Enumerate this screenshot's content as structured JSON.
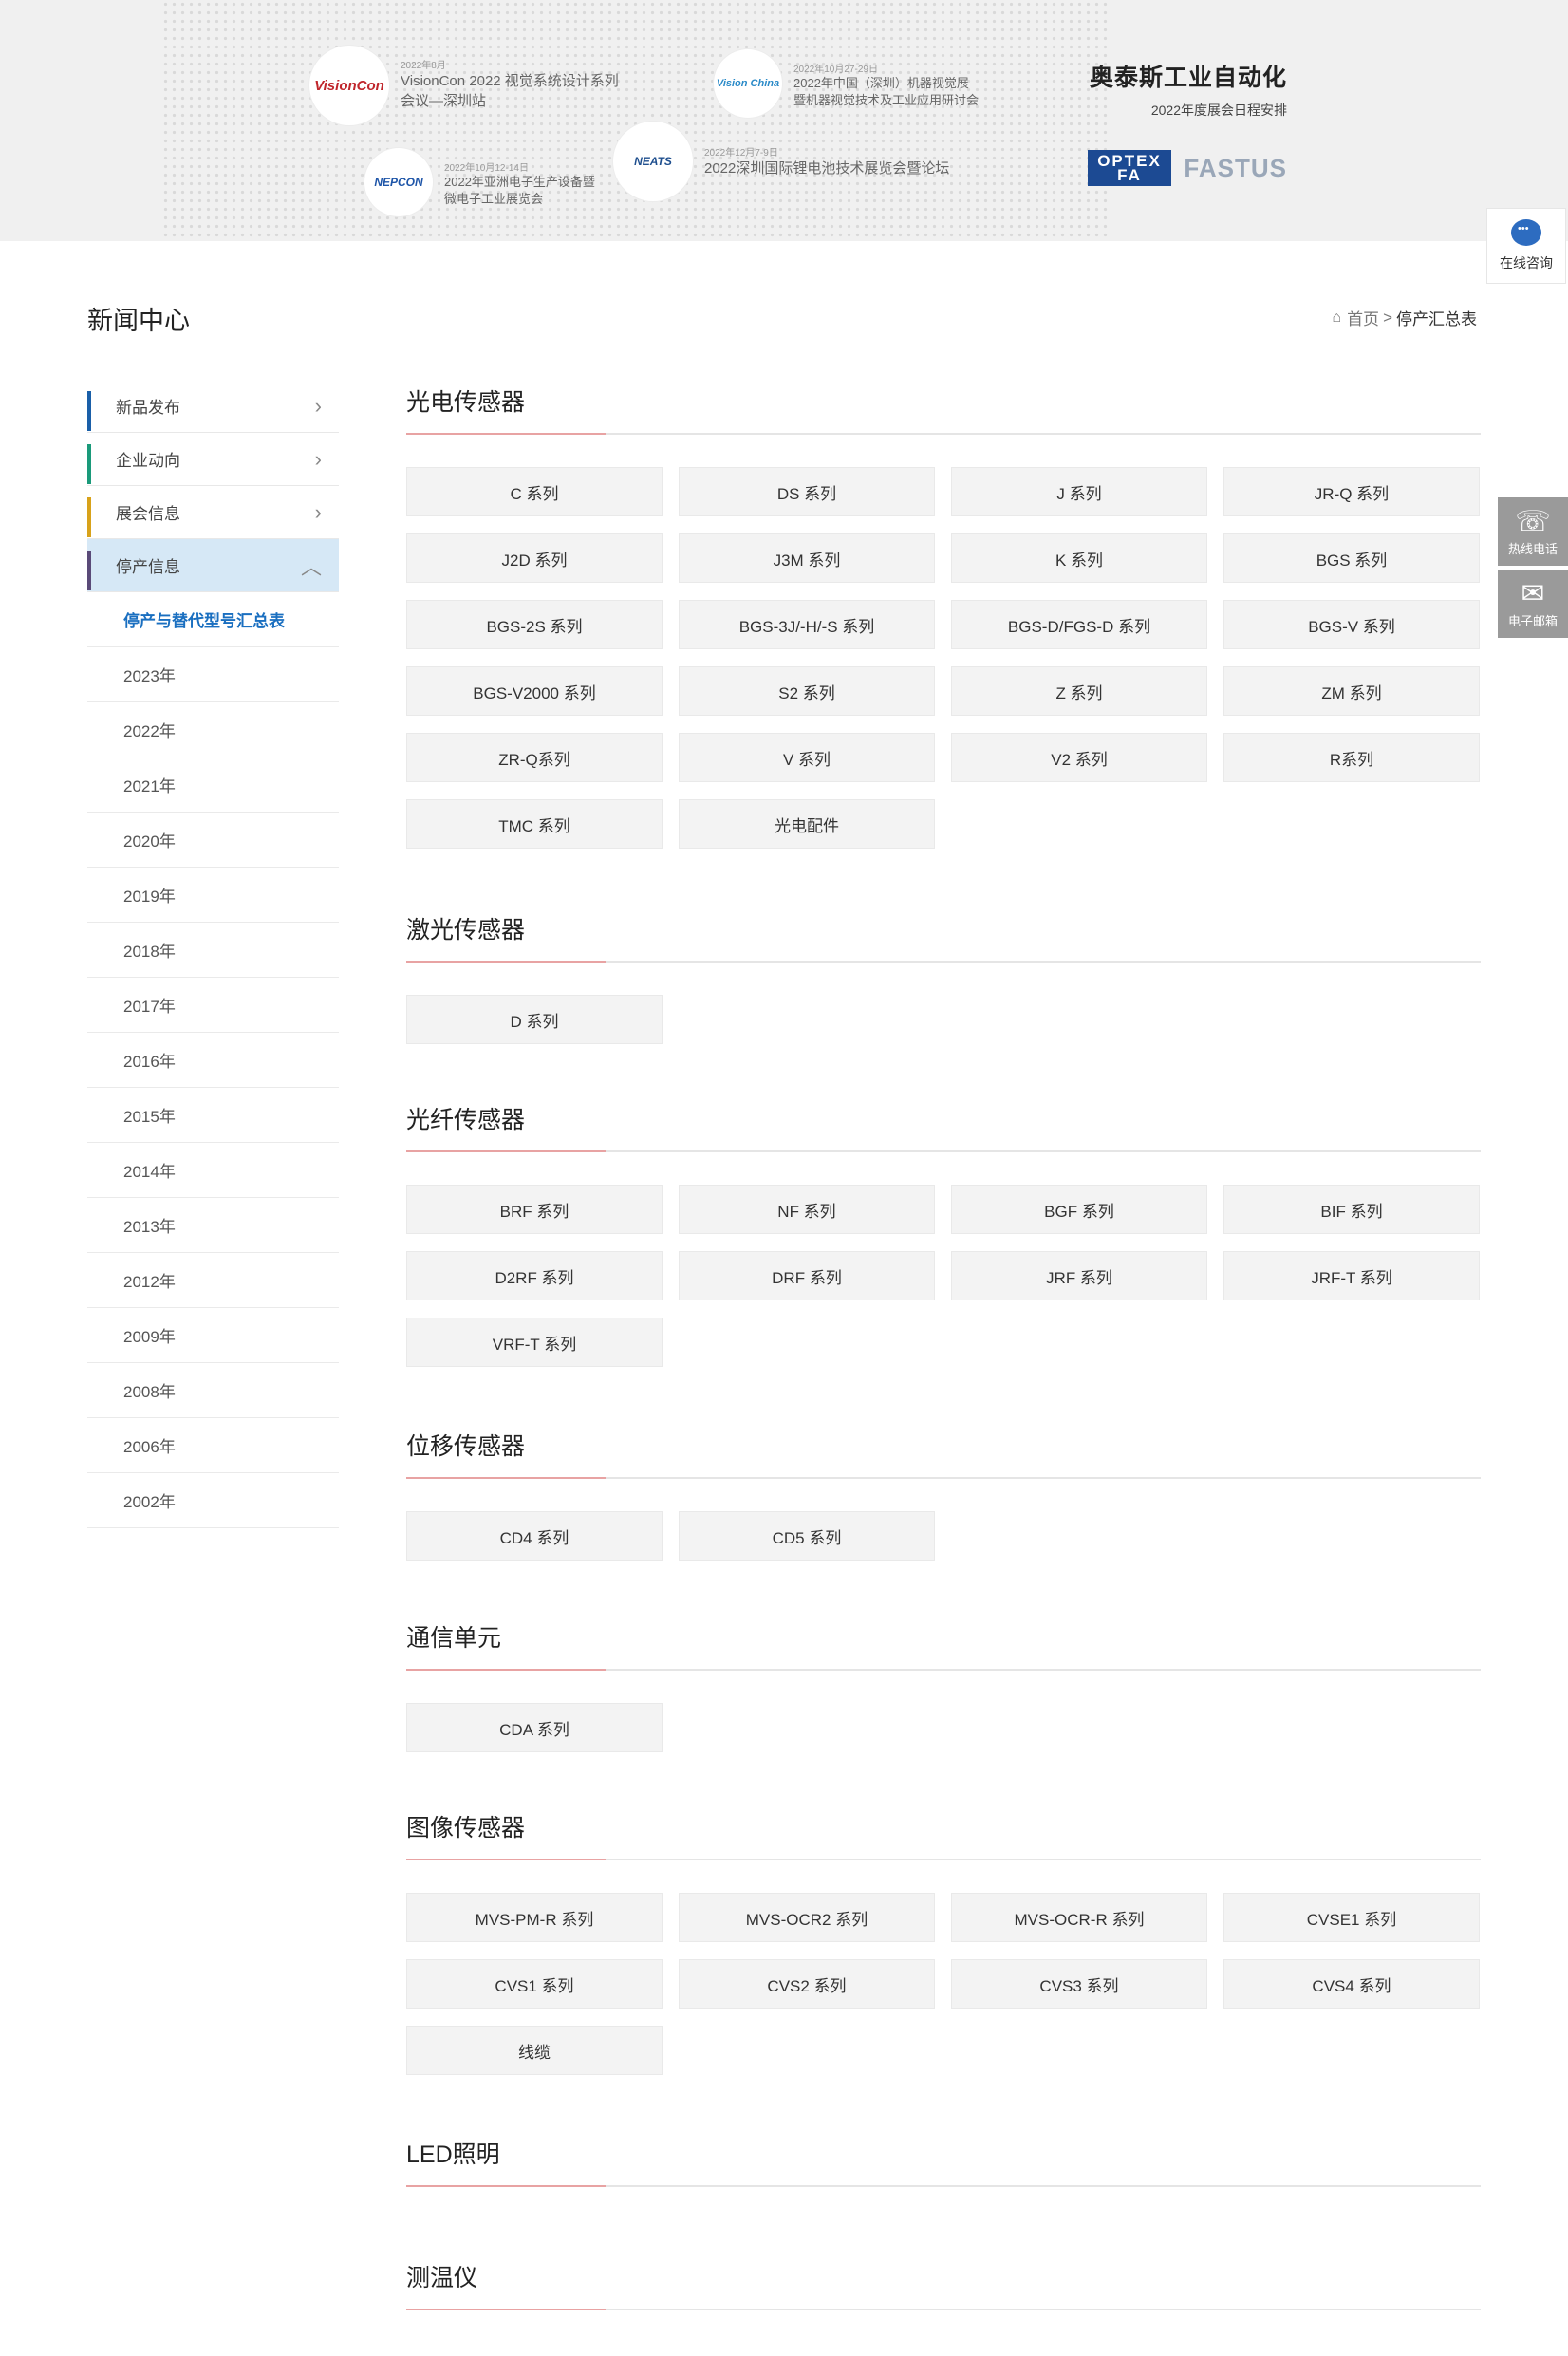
{
  "banner": {
    "events": [
      {
        "logo": "VisionCon",
        "date": "2022年8月",
        "title_line1": "VisionCon 2022 视觉系统设计系列",
        "title_line2": "会议—深圳站"
      },
      {
        "logo": "Vision China",
        "date": "2022年10月27-29日",
        "title_line1": "2022年中国（深圳）机器视觉展",
        "title_line2": "暨机器视觉技术及工业应用研讨会"
      },
      {
        "logo": "NEPCON",
        "date": "2022年10月12-14日",
        "title_line1": "2022年亚洲电子生产设备暨",
        "title_line2": "微电子工业展览会"
      },
      {
        "logo": "NEATS",
        "date": "2022年12月7-9日",
        "title_line1": "2022深圳国际锂电池技术展览会暨论坛",
        "title_line2": ""
      }
    ],
    "brand_title": "奥泰斯工业自动化",
    "brand_sub": "2022年度展会日程安排",
    "logo_optex_top": "OPTEX",
    "logo_optex_bottom": "FA",
    "logo_fastus": "FASTUS"
  },
  "float": {
    "consult": "在线咨询",
    "hotline": "热线电话",
    "email": "电子邮箱"
  },
  "header": {
    "title": "新闻中心",
    "breadcrumb_home": "首页",
    "breadcrumb_sep": ">",
    "breadcrumb_current": "停产汇总表"
  },
  "sidebar": {
    "main_items": [
      {
        "label": "新品发布",
        "color": "#1a5fa8"
      },
      {
        "label": "企业动向",
        "color": "#1a9a7a"
      },
      {
        "label": "展会信息",
        "color": "#d8a21a"
      },
      {
        "label": "停产信息",
        "color": "#5a4a78"
      }
    ],
    "sub_items": [
      "停产与替代型号汇总表",
      "2023年",
      "2022年",
      "2021年",
      "2020年",
      "2019年",
      "2018年",
      "2017年",
      "2016年",
      "2015年",
      "2014年",
      "2013年",
      "2012年",
      "2009年",
      "2008年",
      "2006年",
      "2002年"
    ]
  },
  "sections": [
    {
      "title": "光电传感器",
      "items": [
        "C 系列",
        "DS 系列",
        "J 系列",
        "JR-Q 系列",
        "J2D 系列",
        "J3M 系列",
        "K 系列",
        "BGS 系列",
        "BGS-2S 系列",
        "BGS-3J/-H/-S 系列",
        "BGS-D/FGS-D 系列",
        "BGS-V 系列",
        "BGS-V2000 系列",
        "S2 系列",
        "Z 系列",
        "ZM 系列",
        "ZR-Q系列",
        "V 系列",
        "V2 系列",
        "R系列",
        "TMC 系列",
        "光电配件"
      ]
    },
    {
      "title": "激光传感器",
      "items": [
        "D 系列"
      ]
    },
    {
      "title": "光纤传感器",
      "items": [
        "BRF 系列",
        "NF 系列",
        "BGF 系列",
        "BIF 系列",
        "D2RF 系列",
        "DRF 系列",
        "JRF 系列",
        "JRF-T 系列",
        "VRF-T 系列"
      ]
    },
    {
      "title": "位移传感器",
      "items": [
        "CD4 系列",
        "CD5 系列"
      ]
    },
    {
      "title": "通信单元",
      "items": [
        "CDA 系列"
      ]
    },
    {
      "title": "图像传感器",
      "items": [
        "MVS-PM-R 系列",
        "MVS-OCR2 系列",
        "MVS-OCR-R 系列",
        "CVSE1 系列",
        "CVS1 系列",
        "CVS2 系列",
        "CVS3 系列",
        "CVS4 系列",
        "线缆"
      ]
    },
    {
      "title": "LED照明",
      "items": []
    },
    {
      "title": "测温仪",
      "items": []
    }
  ]
}
